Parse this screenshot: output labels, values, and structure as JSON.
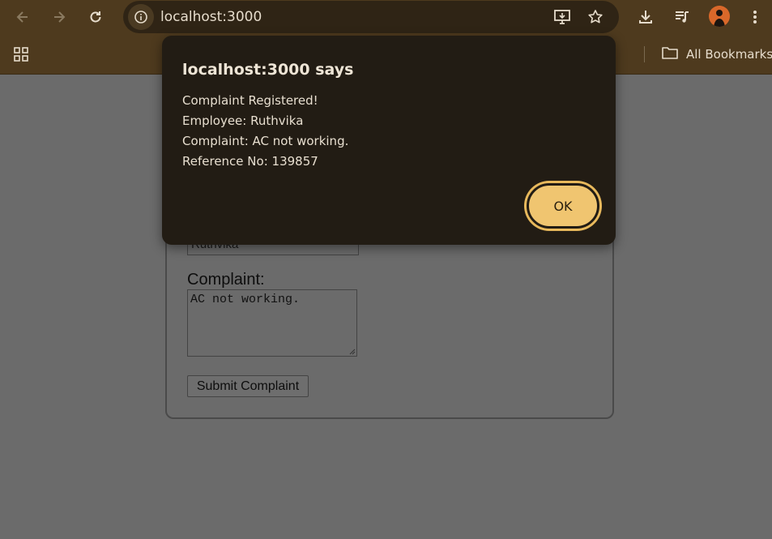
{
  "browser": {
    "url": "localhost:3000",
    "bookmarks_label": "All Bookmarks"
  },
  "form": {
    "employee_value": "Ruthvika",
    "complaint_label": "Complaint:",
    "complaint_value": "AC not working.",
    "submit_label": "Submit Complaint"
  },
  "dialog": {
    "title": "localhost:3000 says",
    "lines": [
      "Complaint Registered!",
      "Employee: Ruthvika",
      "Complaint: AC not working.",
      "Reference No: 139857"
    ],
    "ok_label": "OK"
  },
  "colors": {
    "chrome_bg": "#4e3a1e",
    "dialog_bg": "#221c14",
    "ok_button": "#f0c570",
    "page_overlay": "#6b6b6b"
  }
}
